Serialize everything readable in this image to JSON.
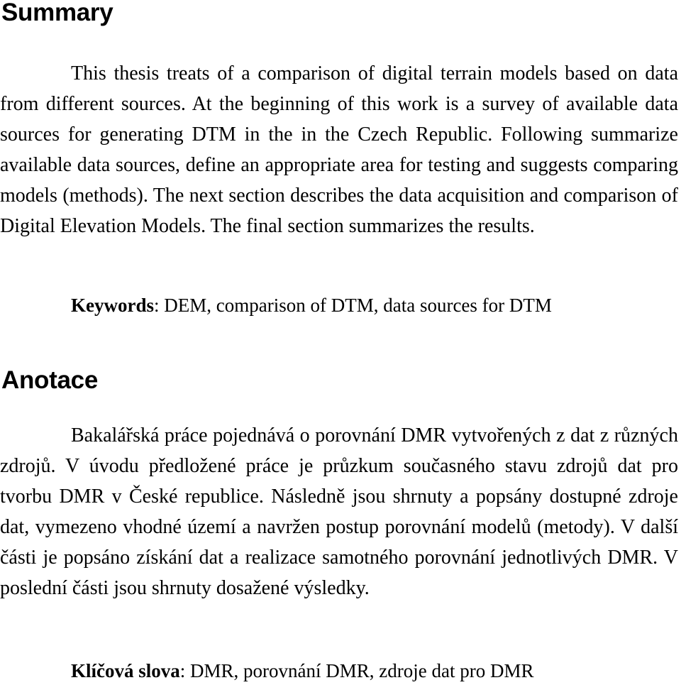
{
  "document": {
    "summary_section": {
      "heading": "Summary",
      "paragraph": "This thesis treats of a comparison of digital terrain models based on data from different sources. At the beginning of this work is a survey of available data sources for generating DTM in the in the Czech Republic. Following summarize available data sources, define an appropriate area for testing and suggests comparing models (methods). The next section describes the data acquisition and comparison of Digital Elevation Models. The final section summarizes the results.",
      "keywords_label": "Keywords",
      "keywords_separator": ": ",
      "keywords_value": "DEM, comparison of DTM, data sources for DTM"
    },
    "anotace_section": {
      "heading": "Anotace",
      "paragraph": "Bakalářská práce pojednává o porovnání DMR vytvořených z dat z různých zdrojů. V úvodu předložené práce je průzkum současného stavu zdrojů dat pro tvorbu DMR v České republice. Následně jsou shrnuty a popsány dostupné zdroje dat, vymezeno vhodné území a navržen postup porovnání modelů (metody). V další části je popsáno získání dat a realizace samotného porovnání jednotlivých DMR. V poslední části jsou shrnuty dosažené výsledky.",
      "keywords_label": "Klíčová slova",
      "keywords_separator": ": ",
      "keywords_value": "DMR, porovnání DMR, zdroje dat pro DMR"
    },
    "colors": {
      "text": "#000000",
      "background": "#ffffff"
    }
  }
}
